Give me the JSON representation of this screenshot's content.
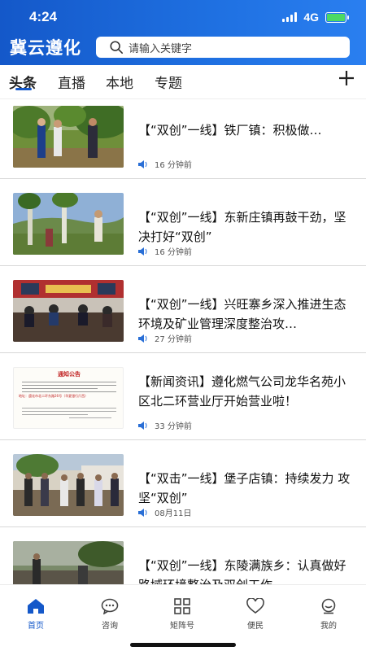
{
  "status_bar": {
    "time": "4:24",
    "network": "4G"
  },
  "header": {
    "title": "冀云遵化",
    "search_placeholder": "请输入关键字"
  },
  "tabs": [
    {
      "label": "头条",
      "active": true
    },
    {
      "label": "直播",
      "active": false
    },
    {
      "label": "本地",
      "active": false
    },
    {
      "label": "专题",
      "active": false
    }
  ],
  "accent_color": "#1458c9",
  "feed": [
    {
      "headline": "【“双创”一线】铁厂镇：积极做…",
      "meta": "16 分钟前"
    },
    {
      "headline": "【“双创”一线】东新庄镇再鼓干劲，坚决打好“双创”",
      "meta": "16 分钟前"
    },
    {
      "headline": "【“双创”一线】兴旺寨乡深入推进生态环境及矿业管理深度整治攻…",
      "meta": "27 分钟前"
    },
    {
      "headline": "【新闻资讯】遵化燃气公司龙华名苑小 区北二环营业厅开始营业啦！",
      "meta": "33 分钟前",
      "notice": {
        "title": "通知公告",
        "address": "地址：遵化市北二环东路26号（华夏银行斤西）"
      }
    },
    {
      "headline": "【“双击”一线】堡子店镇：持续发力 攻坚“双创”",
      "meta": "08月11日"
    },
    {
      "headline": "【“双创”一线】东陵满族乡：认真做好路域环境整治及双创工作",
      "meta": ""
    }
  ],
  "bottom_nav": [
    {
      "label": "首页",
      "icon": "home-icon",
      "active": true
    },
    {
      "label": "咨询",
      "icon": "chat-icon",
      "active": false
    },
    {
      "label": "矩阵号",
      "icon": "grid-icon",
      "active": false
    },
    {
      "label": "便民",
      "icon": "heart-icon",
      "active": false
    },
    {
      "label": "我的",
      "icon": "profile-icon",
      "active": false
    }
  ]
}
